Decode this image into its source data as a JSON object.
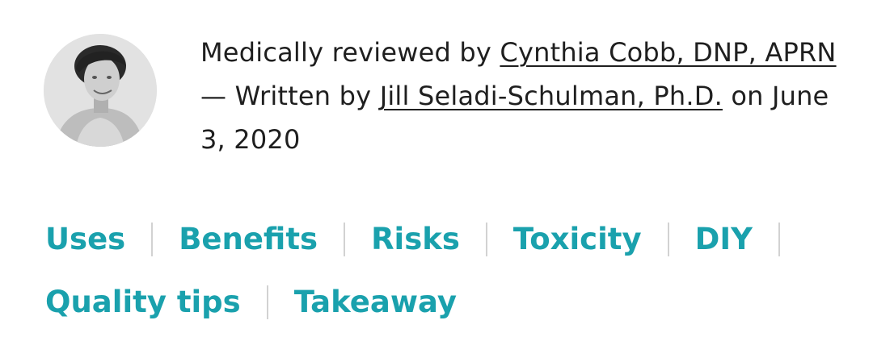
{
  "byline": {
    "prefix_reviewed": "Medically reviewed by ",
    "reviewer_name": "Cynthia Cobb, DNP, APRN",
    "middle_written": " — Written by ",
    "author_name": "Jill Seladi-Schulman, Ph.D.",
    "suffix_date": " on June 3, 2020"
  },
  "toc": {
    "items": [
      "Uses",
      "Benefits",
      "Risks",
      "Toxicity",
      "DIY",
      "Quality tips",
      "Takeaway"
    ]
  },
  "colors": {
    "toc_link": "#1aa1ad",
    "text": "#1f1f1f",
    "separator": "#d2d2d2"
  }
}
